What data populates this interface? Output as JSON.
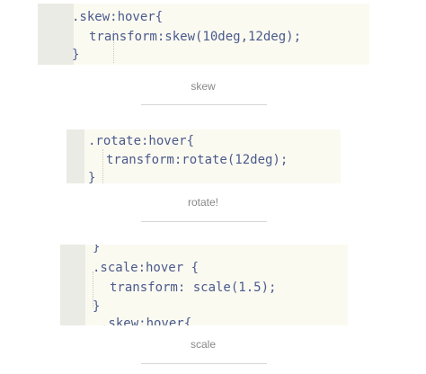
{
  "skew_section": {
    "code": {
      "line0": "'",
      "line1": ".skew:hover{",
      "line2": "transform:skew(10deg,12deg);",
      "line3": "}"
    },
    "caption": "skew"
  },
  "rotate_section": {
    "code": {
      "line1": ".rotate:hover{",
      "line2": "transform:rotate(12deg);",
      "line3": "}"
    },
    "caption": "rotate!"
  },
  "scale_section": {
    "code": {
      "line0": "}",
      "line1": ".scale:hover {",
      "line2": "transform: scale(1.5);",
      "line3": "}",
      "line4": ".skew:hover{"
    },
    "caption": "scale"
  },
  "colors": {
    "code_background": "#fbfaf1",
    "gutter": "#ebebe5",
    "code_text": "#4a5a8c",
    "caption_text": "#888888",
    "divider": "#d6d6d6"
  }
}
